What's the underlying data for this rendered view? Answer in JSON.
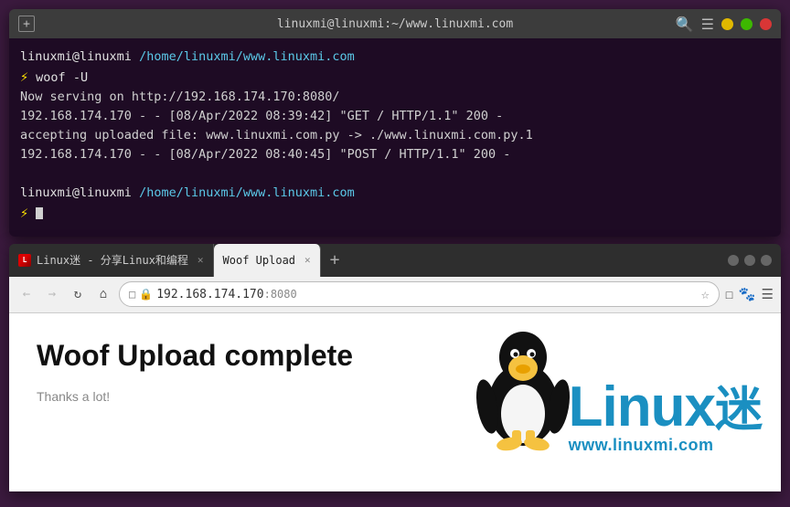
{
  "terminal": {
    "title": "linuxmi@linuxmi:~/www.linuxmi.com",
    "line1_prompt": "linuxmi@linuxmi",
    "line1_path": "/home/linuxmi/www.linuxmi.com",
    "line1_bolt": "⚡",
    "line1_cmd": "woof",
    "line1_flag": "-U",
    "line2": "Now serving on http://192.168.174.170:8080/",
    "line3": "192.168.174.170 - - [08/Apr/2022 08:39:42] \"GET / HTTP/1.1\" 200 -",
    "line4": "accepting uploaded file: www.linuxmi.com.py -> ./www.linuxmi.com.py.1",
    "line5": "192.168.174.170 - - [08/Apr/2022 08:40:45] \"POST / HTTP/1.1\" 200 -",
    "line6_prompt": "linuxmi@linuxmi",
    "line6_path": "/home/linuxmi/www.linuxmi.com",
    "line6_bolt": "⚡"
  },
  "browser": {
    "tab1_label": "Linux迷 - 分享Linux和编程",
    "tab2_label": "Woof Upload",
    "tab_new": "+",
    "nav_back": "←",
    "nav_forward": "→",
    "nav_refresh": "↻",
    "nav_home": "⌂",
    "address_shield": "🛡",
    "address_lock": "🔒",
    "address_url": "192.168.174.170",
    "address_port": ":8080",
    "page_title": "Woof Upload complete",
    "page_thanks": "Thanks a lot!",
    "linux_word": "Linux",
    "linux_mi": "迷",
    "linux_url": "www.linuxmi.com"
  }
}
